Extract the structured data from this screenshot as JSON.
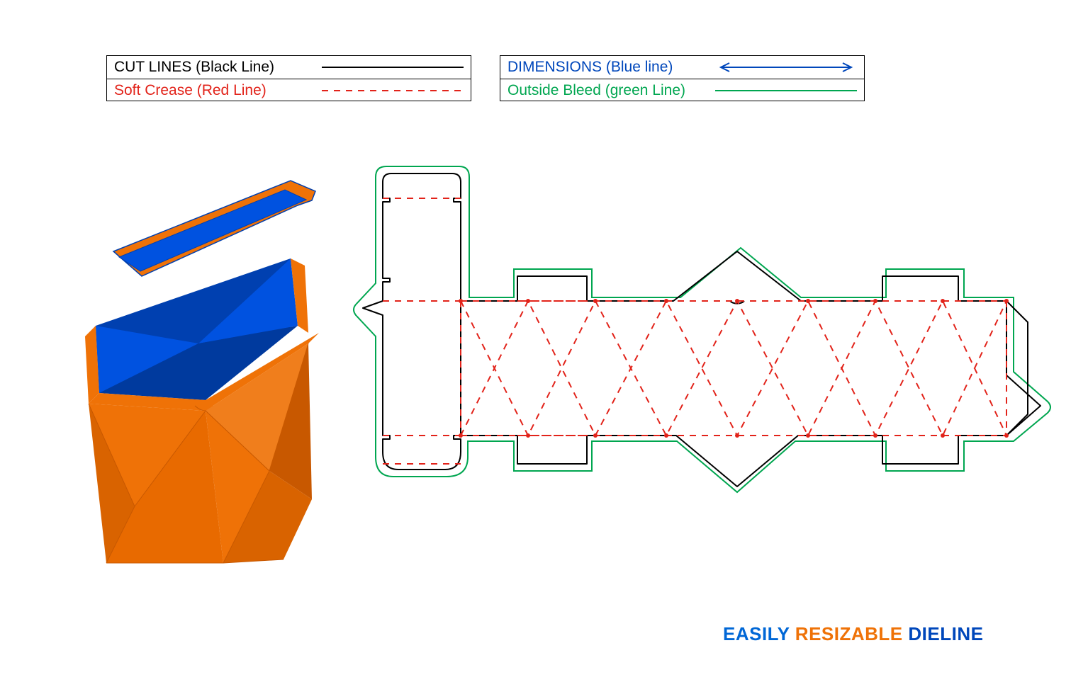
{
  "legend": {
    "left": {
      "row1": {
        "label": "CUT LINES (Black Line)",
        "color": "#000000",
        "style": "solid"
      },
      "row2": {
        "label": "Soft Crease (Red Line)",
        "color": "#e2231a",
        "style": "dashed"
      }
    },
    "right": {
      "row1": {
        "label": "DIMENSIONS (Blue line)",
        "color": "#0047bb",
        "style": "arrow"
      },
      "row2": {
        "label": "Outside Bleed (green Line)",
        "color": "#00a650",
        "style": "solid"
      }
    }
  },
  "tagline": {
    "w1": "EASILY",
    "w2": "RESIZABLE",
    "w3": "DIELINE"
  },
  "colors": {
    "box_outer": "#ef7207",
    "box_outer_shade1": "#d96300",
    "box_outer_shade2": "#c85800",
    "box_inner": "#0052e0",
    "box_inner_shade": "#0040b0",
    "cut": "#000000",
    "crease": "#e2231a",
    "bleed": "#00a650",
    "dimension": "#0047bb"
  },
  "diagram": {
    "description": "Packaging dieline template for a faceted triangular-base box with tuck top and bottom, shown as flat die-cut layout with cut lines (black), soft crease fold lines (red dashed) and outside bleed (green). A 3D render of the assembled orange box with blue interior is shown open on the left.",
    "units": "relative",
    "panels": 6,
    "flaps": {
      "top": 1,
      "bottom": 1,
      "dust": 4,
      "glue": 1
    }
  }
}
